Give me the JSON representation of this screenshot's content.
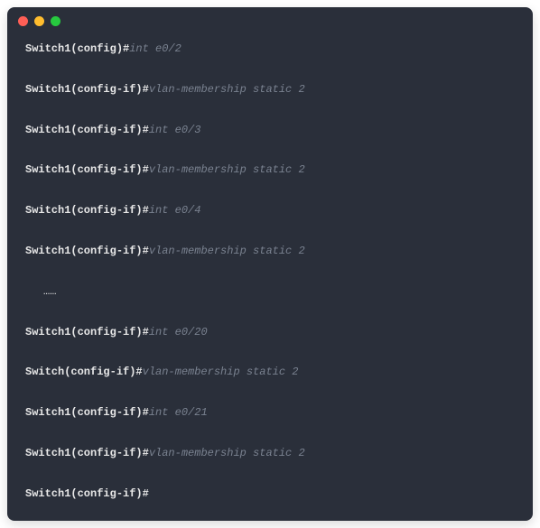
{
  "lines": [
    {
      "type": "cmd",
      "prompt": "Switch1(config)#",
      "command": "int e0/2"
    },
    {
      "type": "cmd",
      "prompt": "Switch1(config-if)#",
      "command": "vlan-membership static 2"
    },
    {
      "type": "cmd",
      "prompt": "Switch1(config-if)#",
      "command": "int e0/3"
    },
    {
      "type": "cmd",
      "prompt": "Switch1(config-if)#",
      "command": "vlan-membership static 2"
    },
    {
      "type": "cmd",
      "prompt": "Switch1(config-if)#",
      "command": "int e0/4"
    },
    {
      "type": "cmd",
      "prompt": "Switch1(config-if)#",
      "command": "vlan-membership static 2"
    },
    {
      "type": "ellipsis",
      "text": "……"
    },
    {
      "type": "cmd",
      "prompt": "Switch1(config-if)#",
      "command": "int e0/20"
    },
    {
      "type": "cmd",
      "prompt": "Switch(config-if)#",
      "command": "vlan-membership static 2"
    },
    {
      "type": "cmd",
      "prompt": "Switch1(config-if)#",
      "command": "int e0/21"
    },
    {
      "type": "cmd",
      "prompt": "Switch1(config-if)#",
      "command": "vlan-membership static 2"
    },
    {
      "type": "cmd",
      "prompt": "Switch1(config-if)#",
      "command": ""
    }
  ]
}
